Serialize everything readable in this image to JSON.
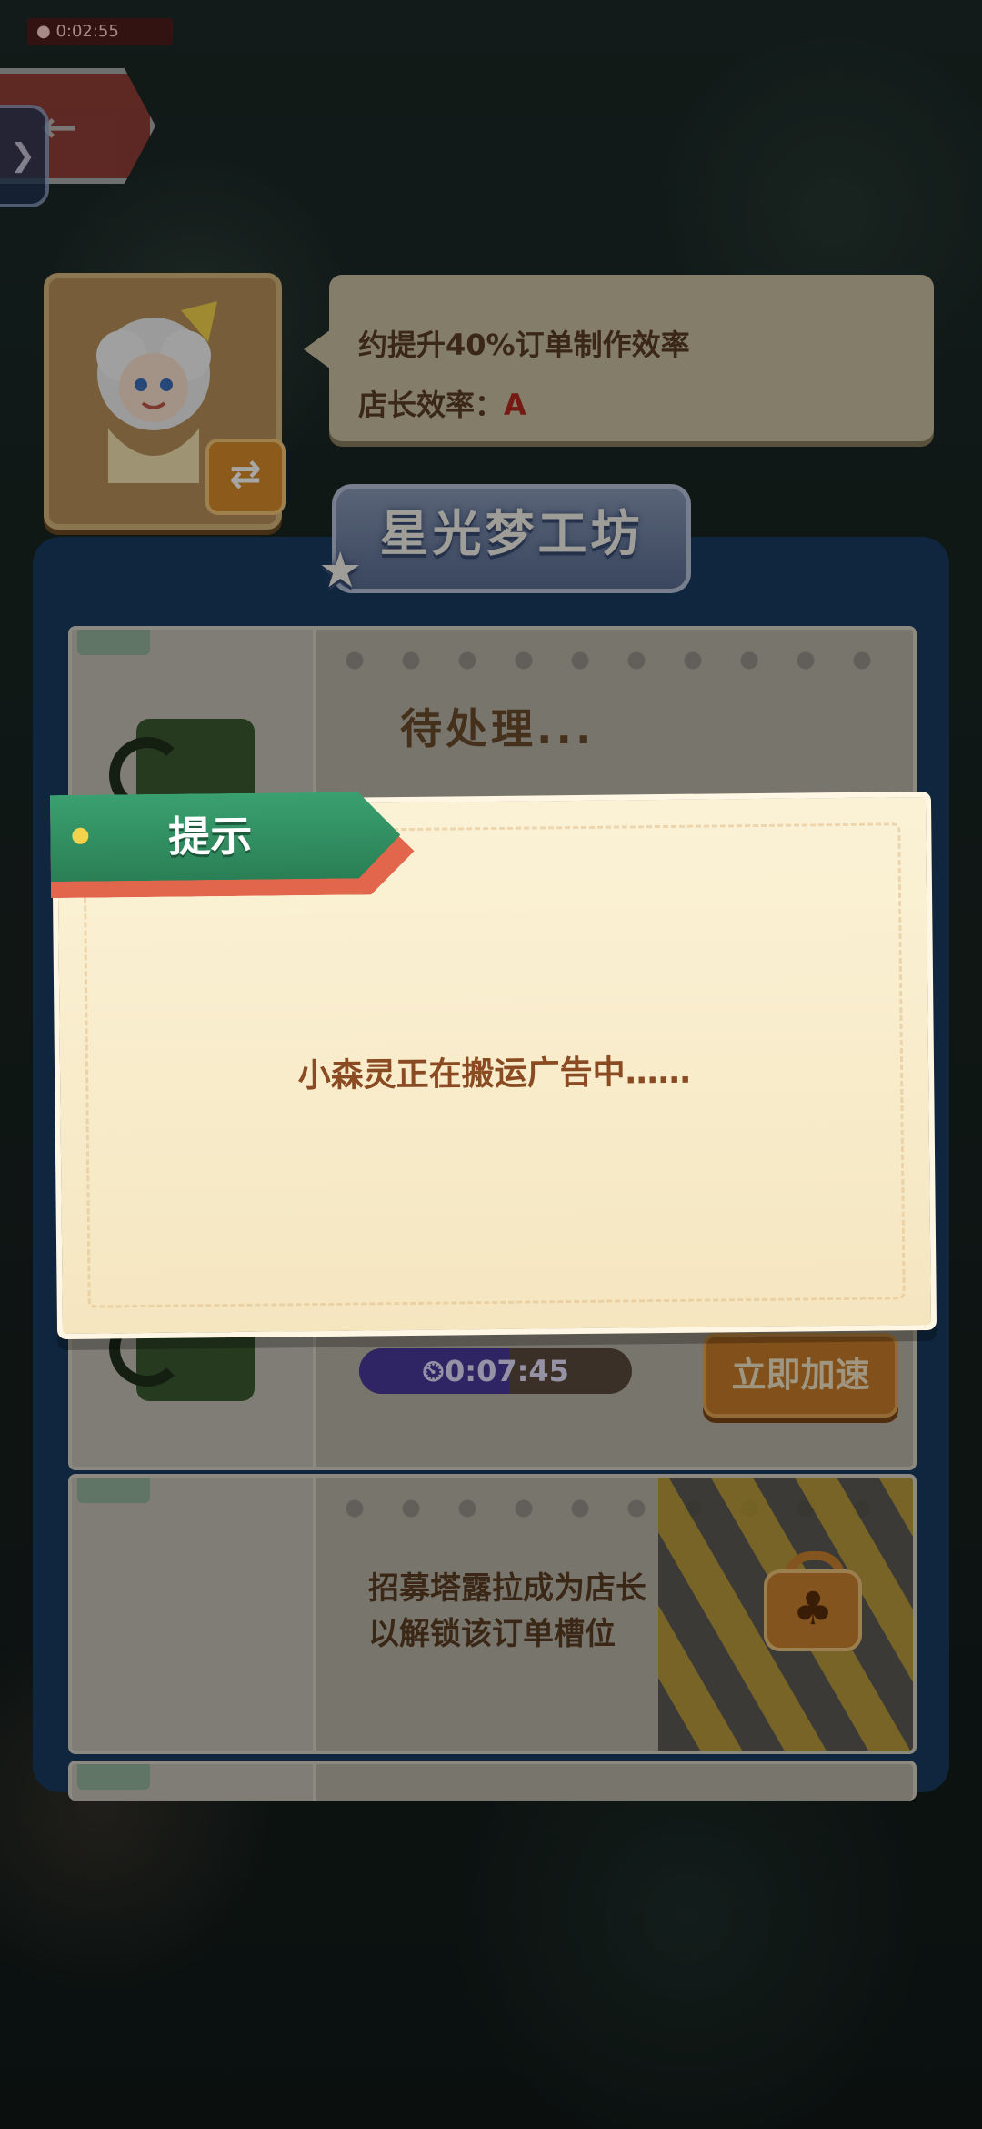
{
  "status_bar": {
    "time": "0:02:55"
  },
  "manager": {
    "info_line1": "约提升40%订单制作效率",
    "info_line2_label": "店长效率：",
    "info_line2_grade": "A"
  },
  "workshop": {
    "title": "星光梦工坊",
    "slot1": {
      "status": "待处理...",
      "timer": "0:07:45",
      "timer_progress": 0.55,
      "speed_button": "立即加速"
    },
    "slot2": {
      "lock_line1": "招募塔露拉成为店长",
      "lock_line2": "以解锁该订单槽位"
    }
  },
  "dialog": {
    "title": "提示",
    "message": "小森灵正在搬运广告中……"
  },
  "colors": {
    "panel": "#173b60",
    "ribbon": "#2a7f55",
    "dialog_text": "#8a4a22"
  },
  "icons": {
    "back": "arrow-left-icon",
    "side_tab": "chevron-right-icon",
    "swap": "swap-arrows-icon",
    "timer": "clock-icon",
    "lock": "padlock-club-icon"
  }
}
